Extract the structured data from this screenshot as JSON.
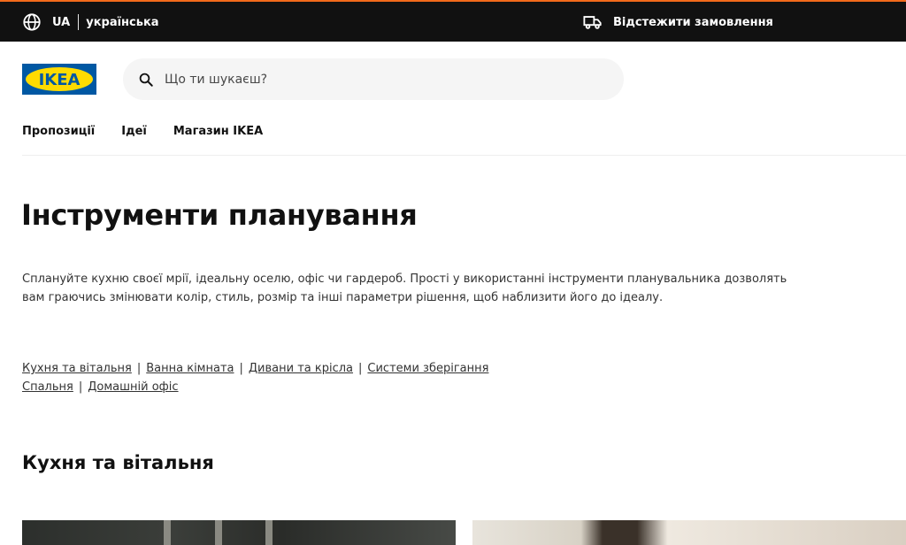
{
  "topbar": {
    "lang_code": "UA",
    "lang_name": "українська",
    "track_order": "Відстежити замовлення"
  },
  "header": {
    "logo_text": "IKEA",
    "search_placeholder": "Що ти шукаєш?"
  },
  "nav": {
    "items": [
      "Пропозиції",
      "Ідеї",
      "Магазин IKEA"
    ]
  },
  "main": {
    "title": "Інструменти планування",
    "intro": "Сплануйте кухню своєї мрії, ідеальну оселю, офіс чи гардероб. Прості у використанні інструменти планувальника дозволять вам граючись змінювати колір, стиль, розмір та інші параметри рішення, щоб наблизити його до ідеалу.",
    "links": [
      "Кухня та вітальня",
      "Ванна кімната",
      "Дивани та крісла",
      "Системи зберігання",
      "Спальня",
      "Домашній офіс"
    ],
    "section_title": "Кухня та вітальня"
  },
  "colors": {
    "ikea_blue": "#0058a3",
    "ikea_yellow": "#ffdb00",
    "topbar_bg": "#111111",
    "accent_line": "#f26a1b"
  }
}
